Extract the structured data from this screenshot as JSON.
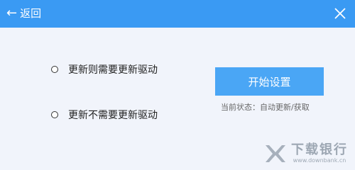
{
  "header": {
    "back_arrow": "←",
    "back_label": "返回",
    "close_icon": "close-icon"
  },
  "options": [
    {
      "label": "更新则需要更新驱动",
      "selected": false
    },
    {
      "label": "更新不需要更新驱动",
      "selected": false
    }
  ],
  "action": {
    "start_label": "开始设置",
    "status_text": "当前状态：自动更新/获取"
  },
  "watermark": {
    "name": "下载银行",
    "url": "www.downbank.cn"
  },
  "colors": {
    "titlebar": "#3a9af3",
    "button": "#4aa6f5",
    "background": "#f1f4fb"
  }
}
